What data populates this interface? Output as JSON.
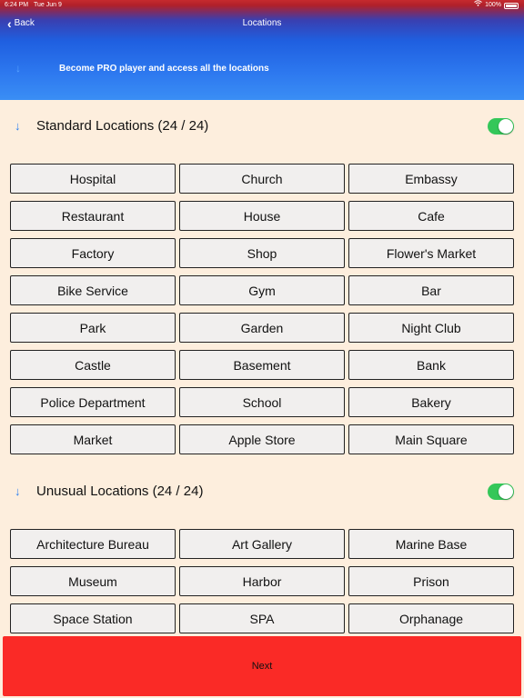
{
  "status_bar": {
    "time": "6:24 PM",
    "date": "Tue Jun 9",
    "battery": "100%"
  },
  "nav": {
    "back_label": "Back",
    "title": "Locations"
  },
  "promo": {
    "text": "Become PRO player and access all the locations",
    "arrow": "↓"
  },
  "standard": {
    "arrow": "↓",
    "title": "Standard Locations  (24 / 24)",
    "enabled": true,
    "items": [
      "Hospital",
      "Church",
      "Embassy",
      "Restaurant",
      "House",
      "Cafe",
      "Factory",
      "Shop",
      "Flower's Market",
      "Bike Service",
      "Gym",
      "Bar",
      "Park",
      "Garden",
      "Night Club",
      "Castle",
      "Basement",
      "Bank",
      "Police Department",
      "School",
      "Bakery",
      "Market",
      "Apple Store",
      "Main Square"
    ]
  },
  "unusual": {
    "arrow": "↓",
    "title": "Unusual Locations  (24 / 24)",
    "enabled": true,
    "items": [
      "Architecture Bureau",
      "Art Gallery",
      "Marine Base",
      "Museum",
      "Harbor",
      "Prison",
      "Space Station",
      "SPA",
      "Orphanage"
    ]
  },
  "next_label": "Next",
  "colors": {
    "background": "#fdeedd",
    "toggle_on": "#34c759",
    "next_button": "#fa2a26",
    "arrow": "#2a7ff0"
  }
}
